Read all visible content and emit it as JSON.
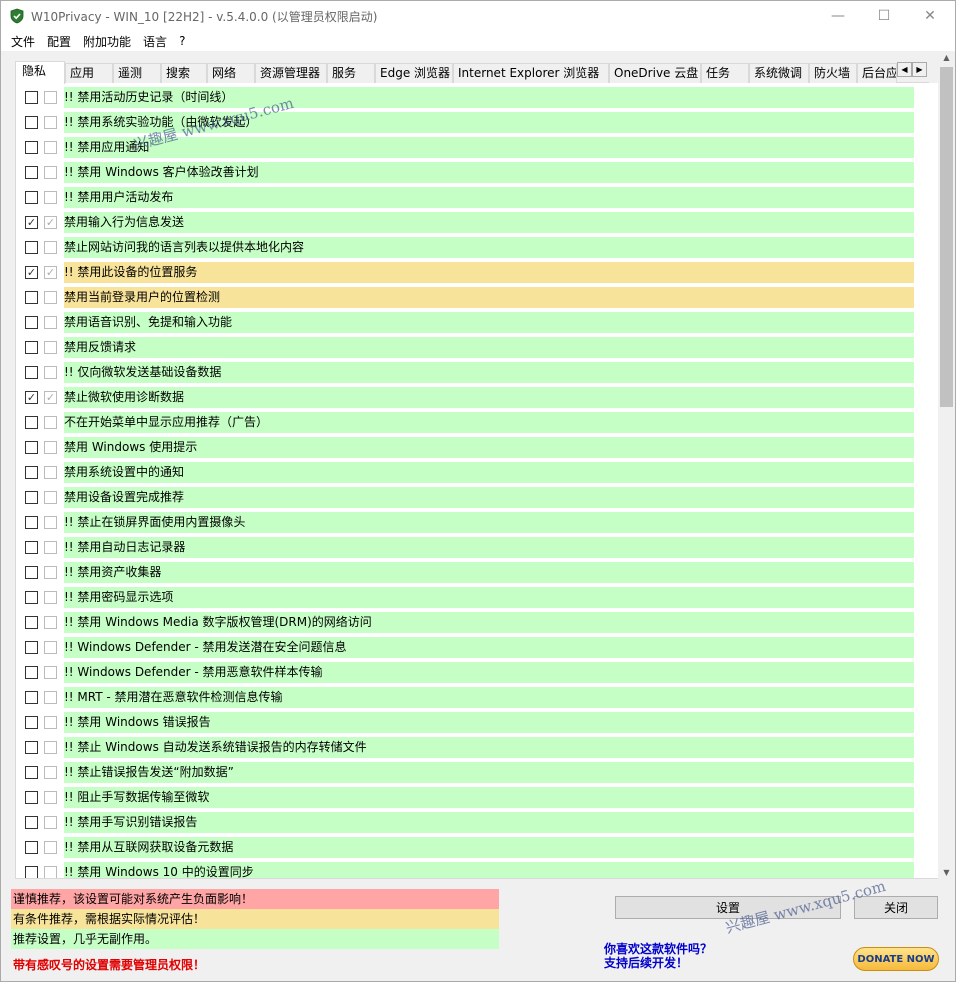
{
  "window": {
    "title": "W10Privacy - WIN_10 [22H2]  - v.5.4.0.0 (以管理员权限启动)",
    "minimize_glyph": "—",
    "maximize_glyph": "☐",
    "close_glyph": "✕"
  },
  "menu": [
    "文件",
    "配置",
    "附加功能",
    "语言",
    "?"
  ],
  "tabs": [
    "隐私",
    "应用",
    "遥测",
    "搜索",
    "网络",
    "资源管理器",
    "服务",
    "Edge 浏览器",
    "Internet Explorer 浏览器",
    "OneDrive 云盘",
    "任务",
    "系统微调",
    "防火墙",
    "后台应"
  ],
  "active_tab": "隐私",
  "tab_scroll": {
    "left": "◀",
    "right": "▶"
  },
  "colors": {
    "green": "#c6ffc6",
    "yellow": "#f7e39a",
    "red": "#ffa5a5"
  },
  "settings": [
    {
      "label": "!! 禁用活动历史记录（时间线）",
      "checked": false,
      "color": "green"
    },
    {
      "label": "!! 禁用系统实验功能（由微软发起）",
      "checked": false,
      "color": "green"
    },
    {
      "label": "!! 禁用应用通知",
      "checked": false,
      "color": "green"
    },
    {
      "label": "!! 禁用 Windows 客户体验改善计划",
      "checked": false,
      "color": "green"
    },
    {
      "label": "!! 禁用用户活动发布",
      "checked": false,
      "color": "green"
    },
    {
      "label": "禁用输入行为信息发送",
      "checked": true,
      "color": "green"
    },
    {
      "label": "禁止网站访问我的语言列表以提供本地化内容",
      "checked": false,
      "color": "green"
    },
    {
      "label": "!! 禁用此设备的位置服务",
      "checked": true,
      "color": "yellow"
    },
    {
      "label": "禁用当前登录用户的位置检测",
      "checked": false,
      "color": "yellow"
    },
    {
      "label": "禁用语音识别、免提和输入功能",
      "checked": false,
      "color": "green"
    },
    {
      "label": "禁用反馈请求",
      "checked": false,
      "color": "green"
    },
    {
      "label": "!! 仅向微软发送基础设备数据",
      "checked": false,
      "color": "green"
    },
    {
      "label": "禁止微软使用诊断数据",
      "checked": true,
      "color": "green"
    },
    {
      "label": "不在开始菜单中显示应用推荐（广告）",
      "checked": false,
      "color": "green"
    },
    {
      "label": "禁用 Windows 使用提示",
      "checked": false,
      "color": "green"
    },
    {
      "label": "禁用系统设置中的通知",
      "checked": false,
      "color": "green"
    },
    {
      "label": "禁用设备设置完成推荐",
      "checked": false,
      "color": "green"
    },
    {
      "label": "!! 禁止在锁屏界面使用内置摄像头",
      "checked": false,
      "color": "green"
    },
    {
      "label": "!! 禁用自动日志记录器",
      "checked": false,
      "color": "green"
    },
    {
      "label": "!! 禁用资产收集器",
      "checked": false,
      "color": "green"
    },
    {
      "label": "!! 禁用密码显示选项",
      "checked": false,
      "color": "green"
    },
    {
      "label": "!! 禁用 Windows Media 数字版权管理(DRM)的网络访问",
      "checked": false,
      "color": "green"
    },
    {
      "label": "!! Windows Defender - 禁用发送潜在安全问题信息",
      "checked": false,
      "color": "green"
    },
    {
      "label": "!! Windows Defender - 禁用恶意软件样本传输",
      "checked": false,
      "color": "green"
    },
    {
      "label": "!! MRT - 禁用潜在恶意软件检测信息传输",
      "checked": false,
      "color": "green"
    },
    {
      "label": "!! 禁用 Windows 错误报告",
      "checked": false,
      "color": "green"
    },
    {
      "label": "!! 禁止 Windows 自动发送系统错误报告的内存转储文件",
      "checked": false,
      "color": "green"
    },
    {
      "label": "!! 禁止错误报告发送“附加数据”",
      "checked": false,
      "color": "green"
    },
    {
      "label": "!! 阻止手写数据传输至微软",
      "checked": false,
      "color": "green"
    },
    {
      "label": "!! 禁用手写识别错误报告",
      "checked": false,
      "color": "green"
    },
    {
      "label": "!! 禁用从互联网获取设备元数据",
      "checked": false,
      "color": "green"
    },
    {
      "label": "!! 禁用 Windows 10 中的设置同步",
      "checked": false,
      "color": "green"
    }
  ],
  "legend": {
    "red": "谨慎推荐，该设置可能对系统产生负面影响！",
    "yellow": "有条件推荐，需根据实际情况评估！",
    "green": "推荐设置，几乎无副作用。"
  },
  "admin_note": "带有感叹号的设置需要管理员权限！",
  "buttons": {
    "apply": "设置",
    "close": "关闭"
  },
  "support": {
    "line1": "你喜欢这款软件吗？",
    "line2": "支持后续开发！"
  },
  "donate_label": "DONATE NOW",
  "watermark": "兴趣屋 www.xqu5.com",
  "check_glyph": "✓"
}
